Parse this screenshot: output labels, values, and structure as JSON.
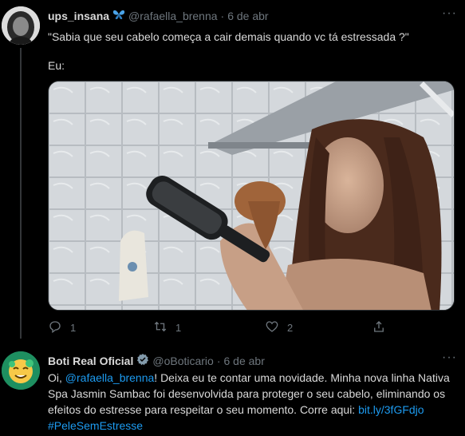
{
  "tweet1": {
    "display_name": "ups_insana",
    "handle": "@rafaella_brenna",
    "date": "6 de abr",
    "text_line1": "\"Sabia que seu cabelo começa a cair demais quando vc tá estressada ?\"",
    "text_line2": "Eu:",
    "reply_count": "1",
    "retweet_count": "1",
    "like_count": "2",
    "more_label": "···"
  },
  "tweet2": {
    "display_name": "Boti Real Oficial",
    "handle": "@oBoticario",
    "date": "6 de abr",
    "more_label": "···",
    "text_part1": "Oi, ",
    "mention": "@rafaella_brenna",
    "text_part2": "! Deixa eu te contar uma novidade. Minha nova linha Nativa Spa Jasmin Sambac foi desenvolvida para proteger o seu cabelo, eliminando os efeitos do estresse para respeitar o seu momento. Corre aqui: ",
    "url": "bit.ly/3fGFdjo",
    "hashtag": "#PeleSemEstresse"
  },
  "separator_dot": "·",
  "colors": {
    "background": "#000000",
    "text": "#d9d9d9",
    "muted": "#6e767d",
    "link": "#1d9bf0",
    "verified": "#829aab"
  },
  "icons": {
    "butterfly": "butterfly-emoji",
    "verified": "verified-badge-icon",
    "reply": "reply-icon",
    "retweet": "retweet-icon",
    "like": "heart-icon",
    "share": "share-icon"
  }
}
